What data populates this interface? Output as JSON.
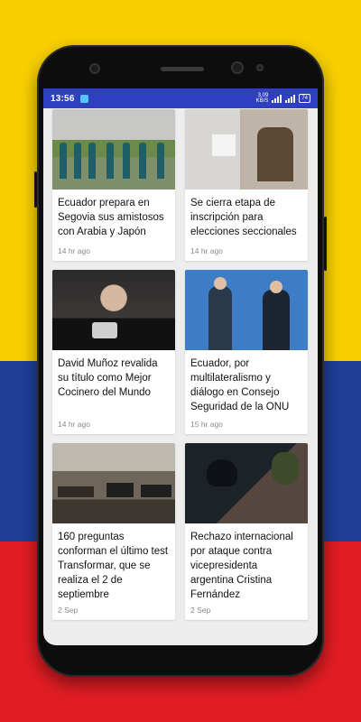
{
  "status_bar": {
    "time": "13:56",
    "speed_value": "3,09",
    "speed_unit": "KB/S",
    "battery": "74"
  },
  "articles": [
    {
      "title": "Ecuador prepara en Segovia sus amistosos con Arabia y Japón",
      "time": "14 hr ago",
      "image": "football-team-training-photo"
    },
    {
      "title": "Se cierra etapa de inscripción para elecciones seccionales",
      "time": "14 hr ago",
      "image": "voter-registration-photo"
    },
    {
      "title": "David Muñoz revalida su título como Mejor Cocinero del Mundo",
      "time": "14 hr ago",
      "image": "chef-award-photo"
    },
    {
      "title": "Ecuador, por multilateralismo y diálogo en Consejo Seguridad de la ONU",
      "time": "15 hr ago",
      "image": "un-meeting-photo"
    },
    {
      "title": "160 preguntas conforman el último test Transformar, que se realiza el 2 de septiembre",
      "time": "2 Sep",
      "image": "classroom-test-photo"
    },
    {
      "title": "Rechazo internacional por ataque contra vicepresidenta argentina Cristina Fernández",
      "time": "2 Sep",
      "image": "police-night-photo"
    }
  ],
  "colors": {
    "status_bar": "#2e3fbf",
    "flag_yellow": "#f7cf00",
    "flag_blue": "#1f3f97",
    "flag_red": "#e11d24"
  }
}
